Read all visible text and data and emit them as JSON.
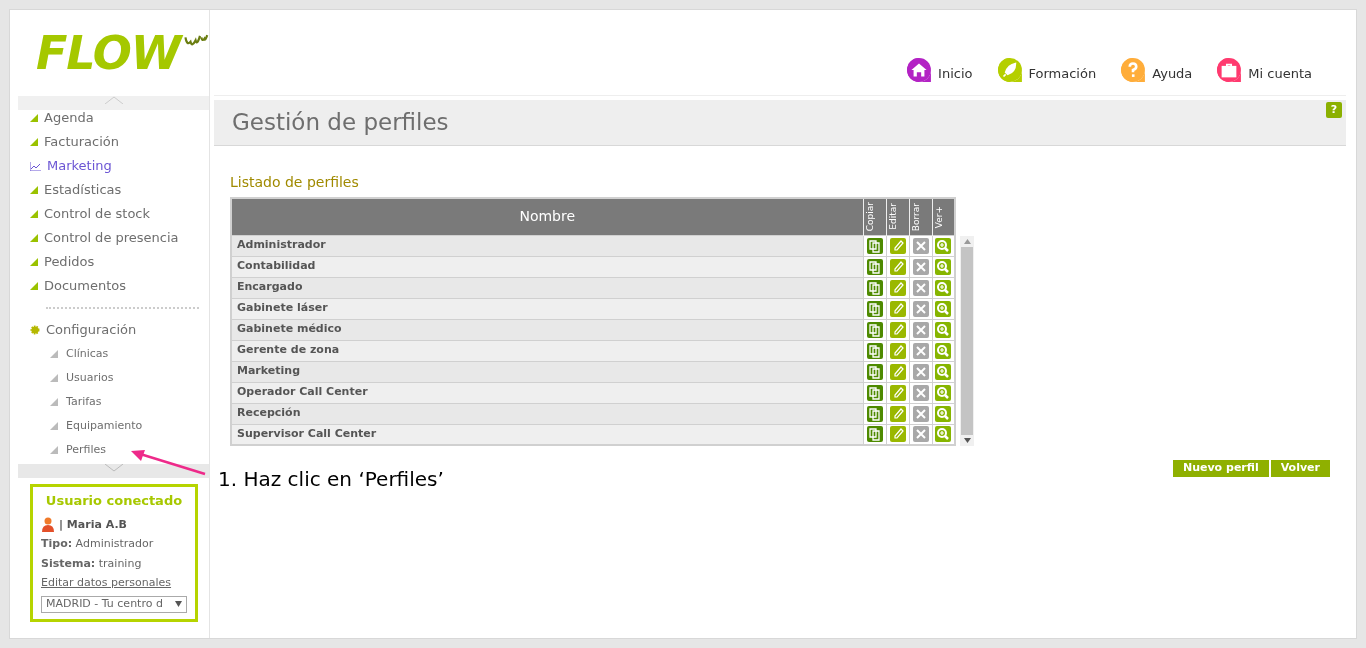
{
  "logo": {
    "text": "FLOW"
  },
  "sidebar": {
    "items": [
      {
        "label": "Agenda",
        "kind": "link",
        "selected": false
      },
      {
        "label": "Facturación",
        "kind": "link",
        "selected": false
      },
      {
        "label": "Marketing",
        "kind": "link",
        "selected": true
      },
      {
        "label": "Estadísticas",
        "kind": "link",
        "selected": false
      },
      {
        "label": "Control de stock",
        "kind": "link",
        "selected": false
      },
      {
        "label": "Control de presencia",
        "kind": "link",
        "selected": false
      },
      {
        "label": "Pedidos",
        "kind": "link",
        "selected": false
      },
      {
        "label": "Documentos",
        "kind": "link",
        "selected": false
      },
      {
        "kind": "separator"
      },
      {
        "label": "Configuración",
        "kind": "section",
        "selected": false,
        "children": [
          {
            "label": "Clínicas"
          },
          {
            "label": "Usuarios"
          },
          {
            "label": "Tarifas"
          },
          {
            "label": "Equipamiento"
          },
          {
            "label": "Perfiles"
          }
        ]
      }
    ]
  },
  "user_panel": {
    "title": "Usuario conectado",
    "name": "| Maria A.B",
    "fields": [
      {
        "label": "Tipo:",
        "value": "Administrador"
      },
      {
        "label": "Sistema:",
        "value": "training"
      }
    ],
    "link": "Editar datos personales",
    "center_select": "MADRID - Tu centro d"
  },
  "top_nav": [
    {
      "label": "Inicio",
      "color": "#b322c4"
    },
    {
      "label": "Formación",
      "color": "#b5cf00"
    },
    {
      "label": "Ayuda",
      "color": "#ffad3a"
    },
    {
      "label": "Mi cuenta",
      "color": "#ff3a6f"
    }
  ],
  "page_title": "Gestión de perfiles",
  "help_badge": "?",
  "section_title": "Listado de perfiles",
  "table": {
    "columns": [
      "Nombre",
      "Copiar",
      "Editar",
      "Borrar",
      "Ver+"
    ],
    "rows": [
      "Administrador",
      "Contabilidad",
      "Encargado",
      "Gabinete láser",
      "Gabinete médico",
      "Gerente de zona",
      "Marketing",
      "Operador Call Center",
      "Recepción",
      "Supervisor Call Center"
    ]
  },
  "buttons": [
    "Nuevo perfil",
    "Volver"
  ],
  "annotation": "1. Haz clic en ‘Perfiles’"
}
